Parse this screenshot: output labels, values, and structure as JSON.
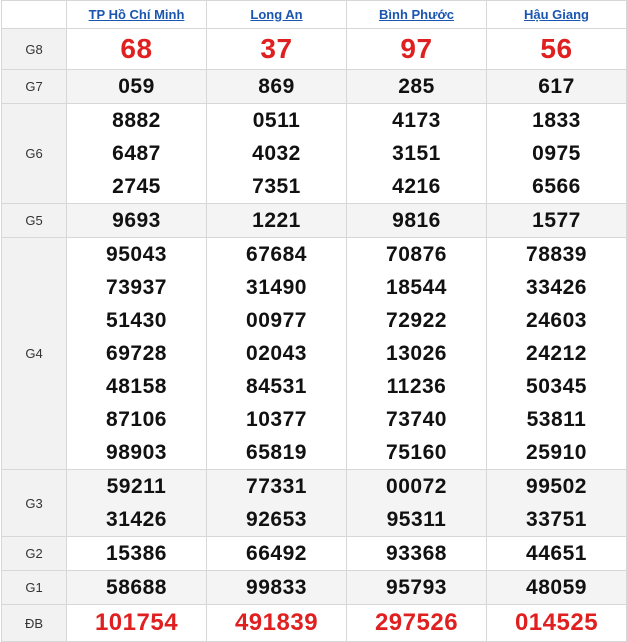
{
  "colors": {
    "header_link": "#1a55b0",
    "special": "#e02020",
    "number": "#111111"
  },
  "provinces": [
    "TP Hồ Chí Minh",
    "Long An",
    "Bình Phước",
    "Hậu Giang"
  ],
  "prizes": [
    {
      "label": "G8",
      "style": "big-red",
      "values": [
        [
          "68"
        ],
        [
          "37"
        ],
        [
          "97"
        ],
        [
          "56"
        ]
      ]
    },
    {
      "label": "G7",
      "style": "normal",
      "values": [
        [
          "059"
        ],
        [
          "869"
        ],
        [
          "285"
        ],
        [
          "617"
        ]
      ]
    },
    {
      "label": "G6",
      "style": "normal",
      "values": [
        [
          "8882",
          "6487",
          "2745"
        ],
        [
          "0511",
          "4032",
          "7351"
        ],
        [
          "4173",
          "3151",
          "4216"
        ],
        [
          "1833",
          "0975",
          "6566"
        ]
      ]
    },
    {
      "label": "G5",
      "style": "normal",
      "values": [
        [
          "9693"
        ],
        [
          "1221"
        ],
        [
          "9816"
        ],
        [
          "1577"
        ]
      ]
    },
    {
      "label": "G4",
      "style": "normal",
      "values": [
        [
          "95043",
          "73937",
          "51430",
          "69728",
          "48158",
          "87106",
          "98903"
        ],
        [
          "67684",
          "31490",
          "00977",
          "02043",
          "84531",
          "10377",
          "65819"
        ],
        [
          "70876",
          "18544",
          "72922",
          "13026",
          "11236",
          "73740",
          "75160"
        ],
        [
          "78839",
          "33426",
          "24603",
          "24212",
          "50345",
          "53811",
          "25910"
        ]
      ]
    },
    {
      "label": "G3",
      "style": "normal",
      "values": [
        [
          "59211",
          "31426"
        ],
        [
          "77331",
          "92653"
        ],
        [
          "00072",
          "95311"
        ],
        [
          "99502",
          "33751"
        ]
      ]
    },
    {
      "label": "G2",
      "style": "normal",
      "values": [
        [
          "15386"
        ],
        [
          "66492"
        ],
        [
          "93368"
        ],
        [
          "44651"
        ]
      ]
    },
    {
      "label": "G1",
      "style": "normal",
      "values": [
        [
          "58688"
        ],
        [
          "99833"
        ],
        [
          "95793"
        ],
        [
          "48059"
        ]
      ]
    },
    {
      "label": "ĐB",
      "style": "db-red",
      "values": [
        [
          "101754"
        ],
        [
          "491839"
        ],
        [
          "297526"
        ],
        [
          "014525"
        ]
      ]
    }
  ]
}
